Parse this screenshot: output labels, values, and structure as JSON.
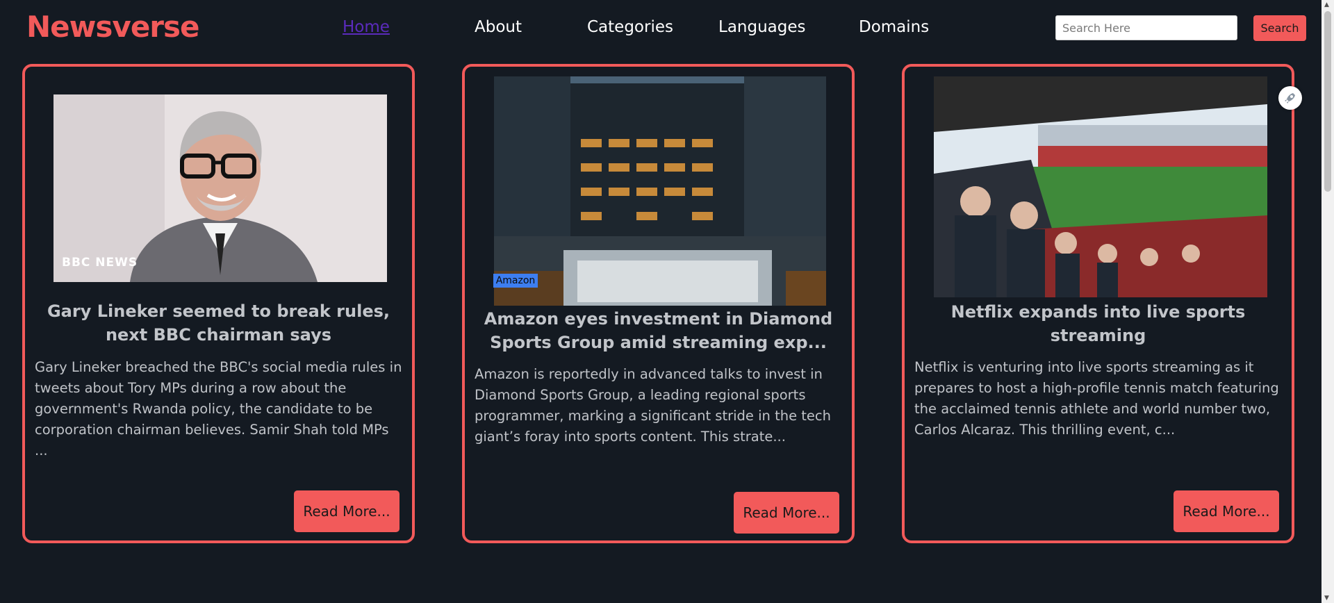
{
  "brand": {
    "name": "Newsverse",
    "color": "#f25a5a"
  },
  "nav": [
    {
      "label": "Home",
      "active": true
    },
    {
      "label": "About"
    },
    {
      "label": "Categories"
    },
    {
      "label": "Languages"
    },
    {
      "label": "Domains"
    }
  ],
  "search": {
    "placeholder": "Search Here",
    "value": "",
    "button": "Search"
  },
  "articles": [
    {
      "image": "photo-of-man-in-glasses-bbc-news",
      "image_watermark": "BBC NEWS",
      "title": "Gary Lineker seemed to break rules, next BBC chairman says",
      "description": "Gary Lineker breached the BBC's social media rules in tweets about Tory MPs during a row about the government's Rwanda policy, the candidate to be corporation chairman believes. Samir Shah told MPs ...",
      "button": "Read More..."
    },
    {
      "image": "photo-of-city-buildings-at-dusk",
      "image_label": "Amazon",
      "title": "Amazon eyes investment in Diamond Sports Group amid streaming exp...",
      "description": "Amazon is reportedly in advanced talks to invest in Diamond Sports Group, a leading regional sports programmer, marking a significant stride in the tech giant’s foray into sports content. This strate...",
      "button": "Read More..."
    },
    {
      "image": "photo-of-football-stadium-crowd",
      "title": "Netflix expands into live sports streaming",
      "description": "Netflix is venturing into live sports streaming as it prepares to host a high-profile tennis match featuring the acclaimed tennis athlete and world number two, Carlos Alcaraz. This thrilling event, c...",
      "button": "Read More..."
    }
  ],
  "colors": {
    "background": "#141a22",
    "accent": "#f25a5a",
    "active_link": "#5b2bbd"
  }
}
